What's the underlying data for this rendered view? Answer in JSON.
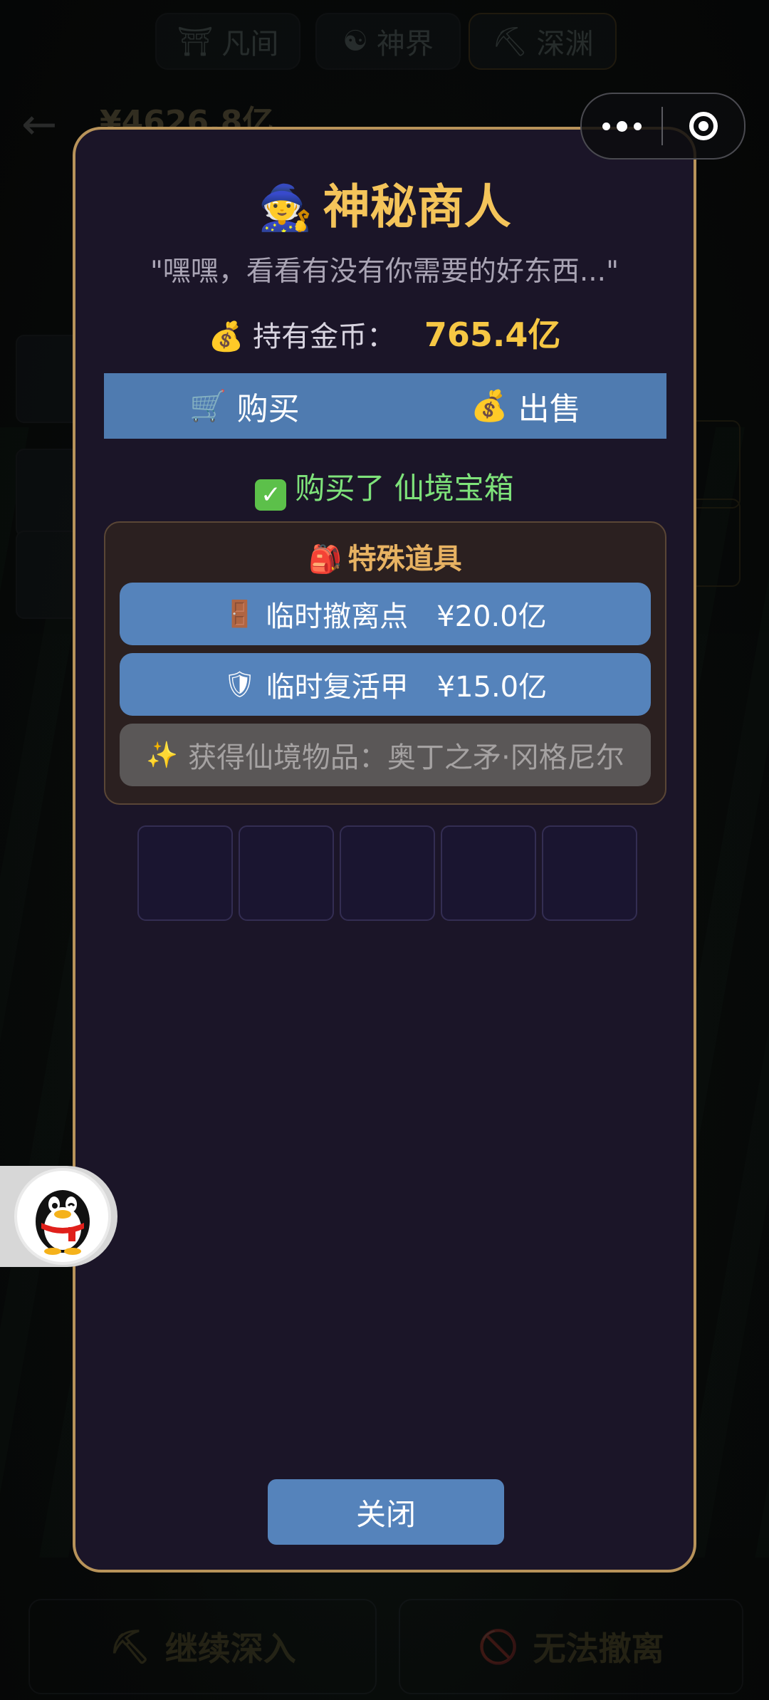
{
  "background": {
    "realm_tabs": [
      {
        "icon": "⛩",
        "label": "凡间"
      },
      {
        "icon": "☯",
        "label": "神界"
      },
      {
        "icon": "⛏",
        "label": "深渊"
      }
    ],
    "gold": "¥4626.8亿",
    "bottom_buttons": [
      {
        "icon": "⛏",
        "label": "继续深入"
      },
      {
        "icon": "🚫",
        "label": "无法撤离"
      }
    ]
  },
  "merchant": {
    "icon": "🧙",
    "title": "神秘商人",
    "quote": "\"嘿嘿，看看有没有你需要的好东西...\"",
    "balance": {
      "icon": "💰",
      "label": "持有金币：",
      "value": "765.4亿"
    },
    "tabs": [
      {
        "icon": "🛒",
        "label": "购买"
      },
      {
        "icon": "💰",
        "label": "出售"
      }
    ],
    "purchase_message": {
      "icon": "✓",
      "text": "购买了 仙境宝箱"
    },
    "special": {
      "icon": "🎒",
      "title": "特殊道具",
      "items": [
        {
          "icon": "🚪",
          "name": "临时撤离点",
          "price": "¥20.0亿"
        },
        {
          "icon": "🛡",
          "name": "临时复活甲",
          "price": "¥15.0亿"
        }
      ],
      "disabled_item": {
        "icon": "✨",
        "text": "获得仙境物品：奥丁之矛·冈格尼尔"
      }
    },
    "close_label": "关闭"
  },
  "colors": {
    "modal_bg": "#1b1528",
    "modal_border": "#b8935a",
    "accent_gold": "#f4c45a",
    "button_blue": "#5583bb",
    "success_green": "#7ee27a"
  }
}
